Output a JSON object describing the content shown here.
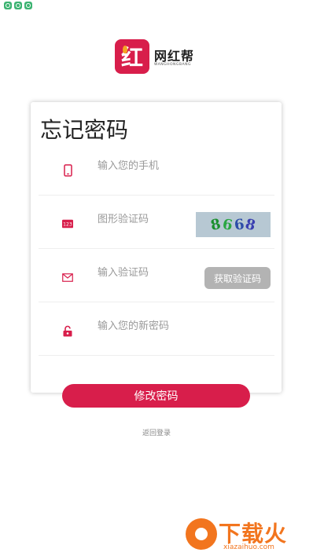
{
  "status_bar": {
    "icons": [
      "app-icon",
      "app-icon",
      "app-icon"
    ]
  },
  "brand": {
    "logo_char": "红",
    "name": "网红帮",
    "subtitle": "WANGHONGBANG"
  },
  "form": {
    "title": "忘记密码",
    "phone_placeholder": "输入您的手机",
    "captcha_placeholder": "图形验证码",
    "captcha_chars": [
      "8",
      "6",
      "6",
      "8"
    ],
    "code_placeholder": "输入验证码",
    "send_code_label": "获取验证码",
    "new_password_placeholder": "输入您的新密码",
    "icons": {
      "phone": "phone-icon",
      "captcha": "number-123-icon",
      "code": "envelope-icon",
      "password": "lock-icon"
    },
    "submit_label": "修改密码",
    "back_label": "返回登录"
  },
  "watermark": {
    "text": "下载火",
    "url": "xiazaihuo.com"
  },
  "colors": {
    "accent": "#d81e4b",
    "disabled": "#b3b3b3",
    "watermark": "#f2751e"
  }
}
